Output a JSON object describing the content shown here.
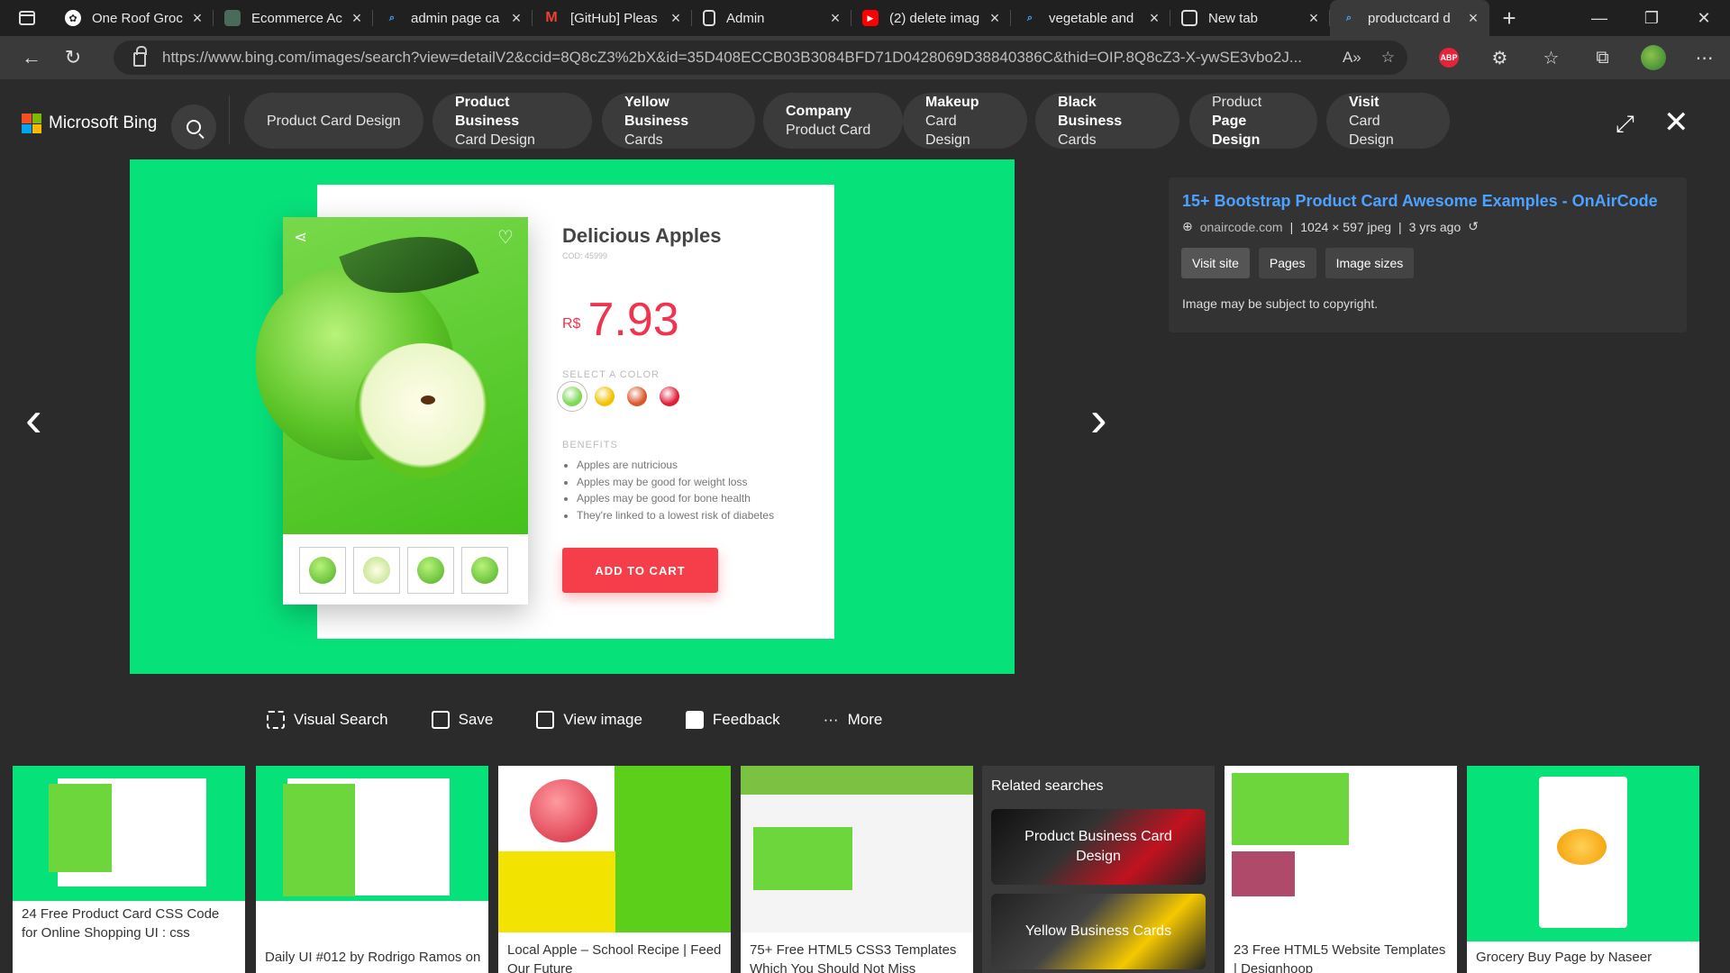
{
  "tabs": [
    {
      "title": "One Roof Groc",
      "active": false
    },
    {
      "title": "Ecommerce Ac",
      "active": false
    },
    {
      "title": "admin page ca",
      "active": false
    },
    {
      "title": "[GitHub] Pleas",
      "active": false
    },
    {
      "title": "Admin",
      "active": false
    },
    {
      "title": "(2) delete imag",
      "active": false
    },
    {
      "title": "vegetable and",
      "active": false
    },
    {
      "title": "New tab",
      "active": false
    },
    {
      "title": "productcard d",
      "active": true
    }
  ],
  "address": {
    "url": "https://www.bing.com/images/search?view=detailV2&ccid=8Q8cZ3%2bX&id=35D408ECCB03B3084BFD71D0428069D38840386C&thid=OIP.8Q8cZ3-X-ywSE3vbo2J..."
  },
  "bing": {
    "logo_text": "Microsoft Bing",
    "chips": [
      {
        "line1": "Product Card Design",
        "line2": ""
      },
      {
        "line1": "Product Business",
        "line2": "Card Design"
      },
      {
        "line1": "Yellow Business",
        "line2": "Cards"
      },
      {
        "line1": "Company",
        "line2": "Product Card"
      },
      {
        "line1": "Makeup",
        "line2": "Card Design"
      },
      {
        "line1": "Black Business",
        "line2": "Cards"
      },
      {
        "line1": "Product",
        "line2": "Page Design"
      },
      {
        "line1": "Visit",
        "line2": "Card Design"
      }
    ]
  },
  "product": {
    "title": "Delicious Apples",
    "cod": "COD: 45999",
    "currency": "R$",
    "price": "7.93",
    "select_color_label": "SELECT A COLOR",
    "colors": [
      "#7ed957",
      "#f2c200",
      "#d9572a",
      "#e01e37"
    ],
    "benefits_label": "BENEFITS",
    "benefits": [
      "Apples are nutricious",
      "Apples may be good for weight loss",
      "Apples may be good for bone health",
      "They're linked to a lowest risk of diabetes"
    ],
    "add_to_cart": "ADD TO CART",
    "background": "#07e17a"
  },
  "info": {
    "title": "15+ Bootstrap Product Card Awesome Examples - OnAirCode",
    "host": "onaircode.com",
    "dims": "1024 × 597 jpeg",
    "age": "3 yrs ago",
    "buttons": [
      "Visit site",
      "Pages",
      "Image sizes"
    ],
    "copyright": "Image may be subject to copyright."
  },
  "actions": [
    "Visual Search",
    "Save",
    "View image",
    "Feedback",
    "More"
  ],
  "results": [
    {
      "caption": "24 Free Product Card CSS Code for Online Shopping UI : css"
    },
    {
      "caption": "Daily UI #012 by Rodrigo Ramos on"
    },
    {
      "caption": "Local Apple – School Recipe | Feed Our Future"
    },
    {
      "caption": "75+ Free HTML5 CSS3 Templates Which You Should Not Miss"
    },
    {
      "caption": "23 Free HTML5 Website Templates | Designhoop"
    },
    {
      "caption": "Grocery Buy Page by Naseer"
    }
  ],
  "related": {
    "title": "Related searches",
    "items": [
      "Product Business Card Design",
      "Yellow Business Cards"
    ]
  }
}
